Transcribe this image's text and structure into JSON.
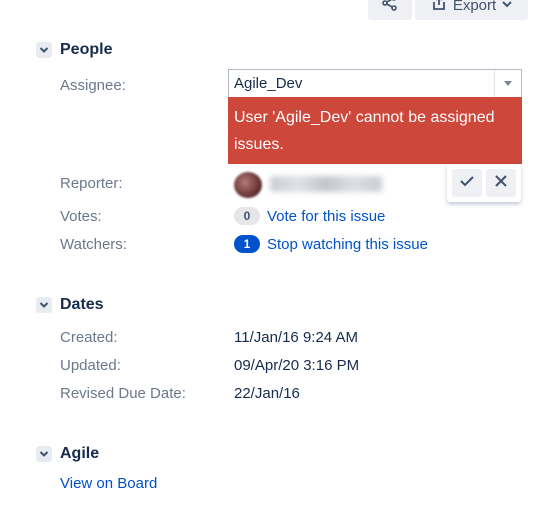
{
  "toolbar": {
    "export_label": "Export"
  },
  "people": {
    "title": "People",
    "assignee_label": "Assignee:",
    "assignee_value": "Agile_Dev",
    "error_message": "User 'Agile_Dev' cannot be assigned issues.",
    "reporter_label": "Reporter:",
    "votes_label": "Votes:",
    "votes_count": "0",
    "vote_link": "Vote for this issue",
    "watchers_label": "Watchers:",
    "watchers_count": "1",
    "watch_link": "Stop watching this issue"
  },
  "dates": {
    "title": "Dates",
    "created_label": "Created:",
    "created_value": "11/Jan/16 9:24 AM",
    "updated_label": "Updated:",
    "updated_value": "09/Apr/20 3:16 PM",
    "revised_due_label": "Revised Due Date:",
    "revised_due_value": "22/Jan/16"
  },
  "agile": {
    "title": "Agile",
    "board_link": "View on Board"
  },
  "colors": {
    "error_bg": "#cd473a",
    "link": "#0052cc",
    "label": "#6b778c"
  }
}
